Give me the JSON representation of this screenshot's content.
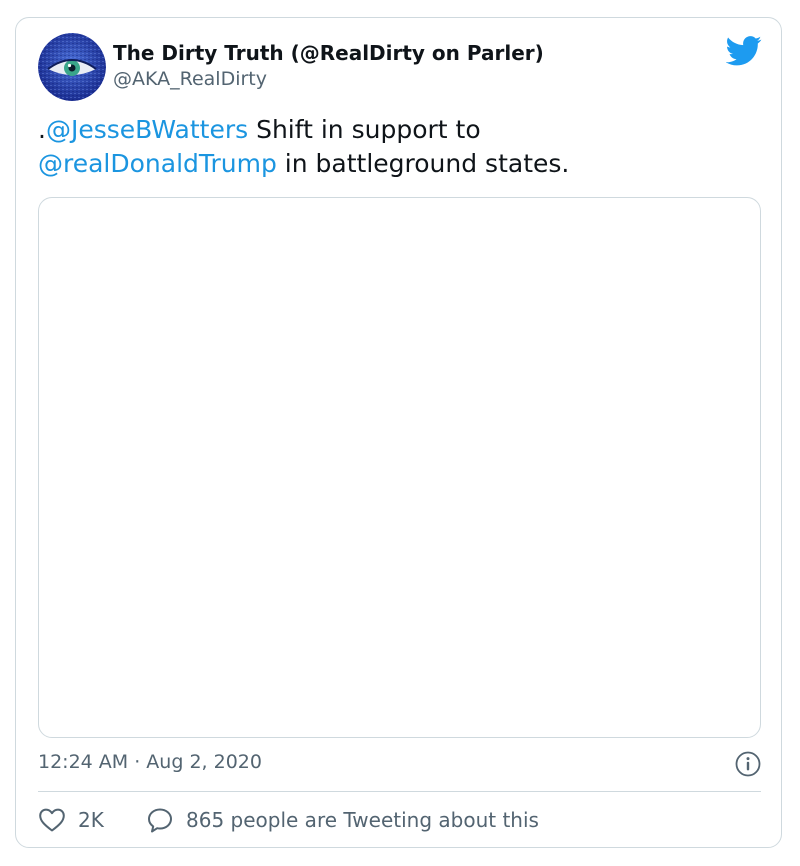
{
  "tweet": {
    "author": {
      "display_name": "The Dirty Truth (@RealDirty on Parler)",
      "handle": "@AKA_RealDirty",
      "avatar_icon": "eye-avatar"
    },
    "text": {
      "prefix": ".",
      "mention_1": "@JesseBWatters",
      "middle": " Shift in support to ",
      "mention_2": "@realDonaldTrump",
      "suffix": " in battleground states."
    },
    "timestamp": "12:24 AM · Aug 2, 2020",
    "actions": {
      "likes_count": "2K",
      "reply_text": "865 people are Tweeting about this"
    }
  },
  "icons": {
    "brand": "twitter-bird-icon",
    "info": "info-icon",
    "like": "heart-icon",
    "reply": "speech-bubble-icon"
  },
  "colors": {
    "brand_blue": "#1d9bf0",
    "mention_blue": "#1b95e0",
    "text_primary": "#0f1419",
    "text_secondary": "#536471",
    "border": "#cfd9de"
  }
}
